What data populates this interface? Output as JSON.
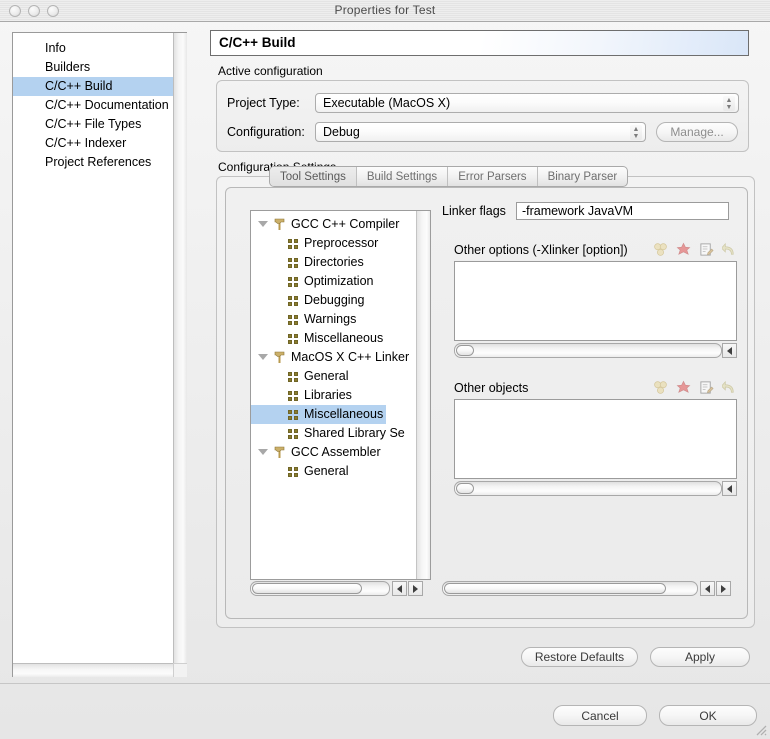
{
  "window": {
    "title": "Properties for Test",
    "controls": [
      "close-button",
      "minimize-button",
      "zoom-button"
    ]
  },
  "sidebar": {
    "items": [
      {
        "label": "Info",
        "selected": false
      },
      {
        "label": "Builders",
        "selected": false
      },
      {
        "label": "C/C++ Build",
        "selected": true
      },
      {
        "label": "C/C++ Documentation",
        "selected": false
      },
      {
        "label": "C/C++ File Types",
        "selected": false
      },
      {
        "label": "C/C++ Indexer",
        "selected": false
      },
      {
        "label": "Project References",
        "selected": false
      }
    ]
  },
  "page": {
    "header_title": "C/C++ Build",
    "active_configuration": {
      "group_label": "Active configuration",
      "project_type_label": "Project Type:",
      "project_type_value": "Executable (MacOS X)",
      "configuration_label": "Configuration:",
      "configuration_value": "Debug",
      "manage_button": "Manage..."
    },
    "configuration_settings": {
      "group_label": "Configuration Settings",
      "tabs": [
        {
          "label": "Tool Settings",
          "active": true
        },
        {
          "label": "Build Settings",
          "active": false
        },
        {
          "label": "Error Parsers",
          "active": false
        },
        {
          "label": "Binary Parser",
          "active": false
        }
      ],
      "tree": [
        {
          "label": "GCC C++ Compiler",
          "level": "parent",
          "icon": "hammer-icon",
          "expanded": true,
          "selected": false
        },
        {
          "label": "Preprocessor",
          "level": "child",
          "icon": "grid-icon",
          "selected": false
        },
        {
          "label": "Directories",
          "level": "child",
          "icon": "grid-icon",
          "selected": false
        },
        {
          "label": "Optimization",
          "level": "child",
          "icon": "grid-icon",
          "selected": false
        },
        {
          "label": "Debugging",
          "level": "child",
          "icon": "grid-icon",
          "selected": false
        },
        {
          "label": "Warnings",
          "level": "child",
          "icon": "grid-icon",
          "selected": false
        },
        {
          "label": "Miscellaneous",
          "level": "child",
          "icon": "grid-icon",
          "selected": false
        },
        {
          "label": "MacOS X C++ Linker",
          "level": "parent",
          "icon": "hammer-icon",
          "expanded": true,
          "selected": false
        },
        {
          "label": "General",
          "level": "child",
          "icon": "grid-icon",
          "selected": false
        },
        {
          "label": "Libraries",
          "level": "child",
          "icon": "grid-icon",
          "selected": false
        },
        {
          "label": "Miscellaneous",
          "level": "child",
          "icon": "grid-icon",
          "selected": true
        },
        {
          "label": "Shared Library Se",
          "level": "child",
          "icon": "grid-icon",
          "selected": false
        },
        {
          "label": "GCC Assembler",
          "level": "parent",
          "icon": "hammer-icon",
          "expanded": true,
          "selected": false
        },
        {
          "label": "General",
          "level": "child",
          "icon": "grid-icon",
          "selected": false
        }
      ],
      "form": {
        "linker_flags_label": "Linker flags",
        "linker_flags_value": "-framework JavaVM",
        "other_options_label": "Other options (-Xlinker [option])",
        "other_options_items": [],
        "other_objects_label": "Other objects",
        "other_objects_items": [],
        "toolbar_icons": [
          "add-icon",
          "delete-icon",
          "edit-icon",
          "undo-icon"
        ]
      }
    },
    "restore_defaults_button": "Restore Defaults",
    "apply_button": "Apply"
  },
  "footer": {
    "cancel_button": "Cancel",
    "ok_button": "OK"
  },
  "colors": {
    "selection_blue": "#b4d2f0",
    "header_gradient_end": "#d9e6f8",
    "tree_icon_olive": "#8a7d2e",
    "hammer_gold": "#b89a4e"
  }
}
